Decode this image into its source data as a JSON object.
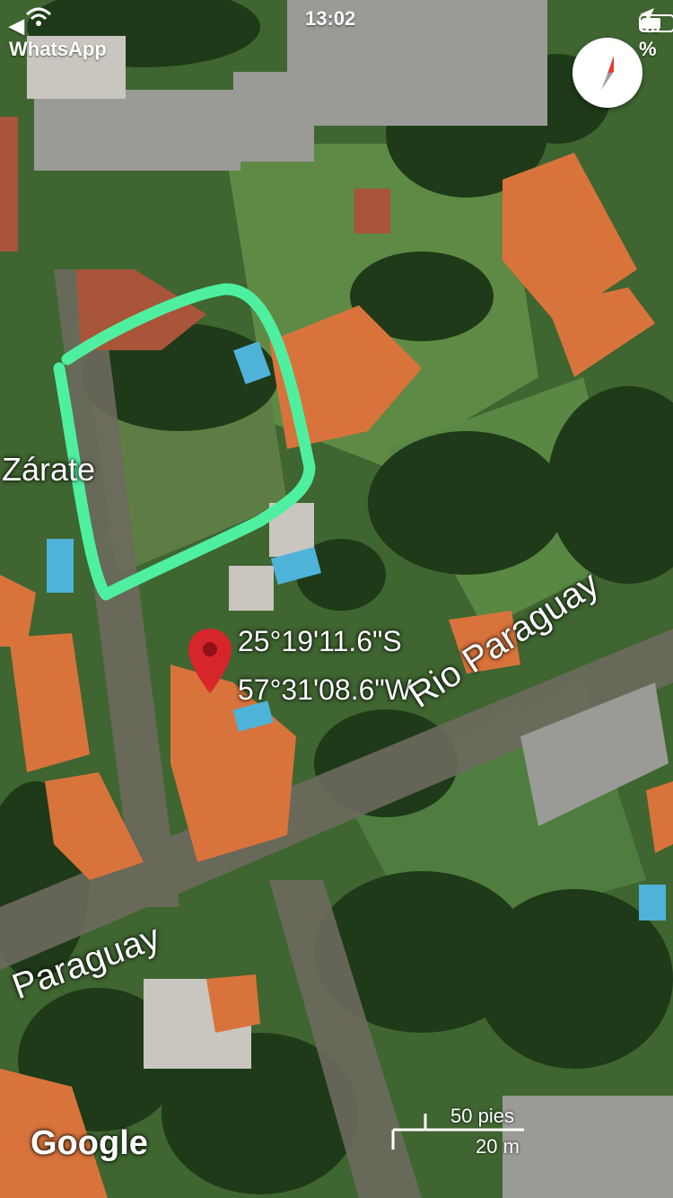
{
  "status_bar": {
    "back_app": "◀ WhatsApp",
    "time": "13:02",
    "battery_percent": "60 %",
    "icons": [
      "wifi-icon",
      "location-arrow-icon",
      "battery-icon"
    ]
  },
  "map": {
    "place_label": "Zárate",
    "coordinates": {
      "lat": "25°19'11.6\"S",
      "lon": "57°31'08.6\"W"
    },
    "streets": [
      "Rio Paraguay",
      "Paraguay"
    ],
    "attribution": "Google",
    "scale": {
      "imperial": "50 pies",
      "metric": "20 m"
    },
    "colors": {
      "highlight_outline": "#4ef0a0",
      "pin": "#d7262b",
      "roof": "#e27a3f",
      "grass": "#4f7a3a",
      "trees": "#1f3d1a"
    },
    "icons": [
      "compass-icon",
      "map-pin-icon"
    ]
  }
}
